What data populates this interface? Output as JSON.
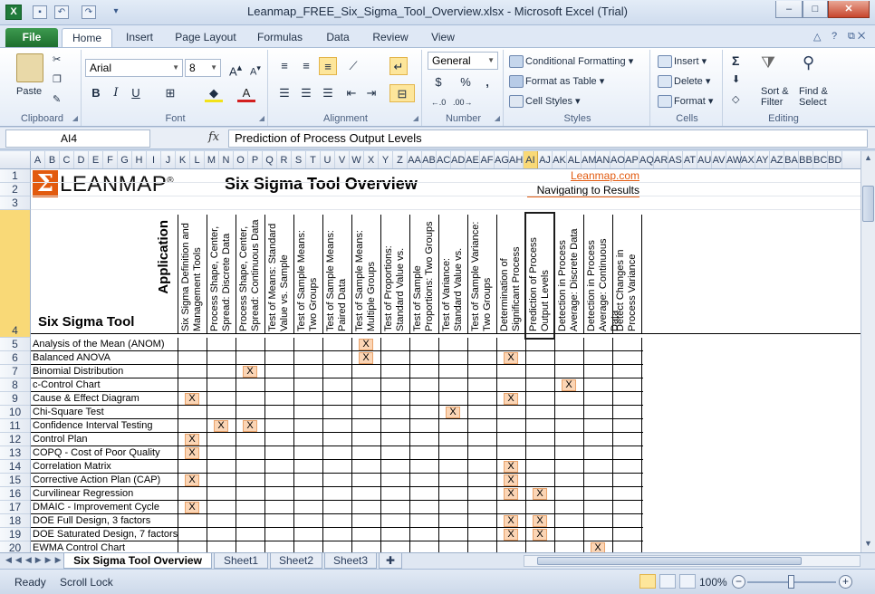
{
  "window": {
    "title": "Leanmap_FREE_Six_Sigma_Tool_Overview.xlsx  -  Microsoft Excel (Trial)",
    "app_icon": "X",
    "buttons": [
      "–",
      "□",
      "✕"
    ]
  },
  "ribbon_tabs": [
    "File",
    "Home",
    "Insert",
    "Page Layout",
    "Formulas",
    "Data",
    "Review",
    "View"
  ],
  "ribbon": {
    "clipboard": {
      "label": "Clipboard",
      "paste": "Paste"
    },
    "font": {
      "label": "Font",
      "name": "Arial",
      "size": "8",
      "bold": "B",
      "italic": "I",
      "underline": "U"
    },
    "alignment": {
      "label": "Alignment"
    },
    "number": {
      "label": "Number",
      "format": "General",
      "currency": "$",
      "percent": "%",
      "comma": ","
    },
    "styles": {
      "label": "Styles",
      "conditional": "Conditional Formatting",
      "format_table": "Format as Table",
      "cell_styles": "Cell Styles"
    },
    "cells": {
      "label": "Cells",
      "insert": "Insert",
      "delete": "Delete",
      "format": "Format"
    },
    "editing": {
      "label": "Editing",
      "sum": "Σ",
      "sort": "Sort &",
      "filter": "Filter",
      "find": "Find &",
      "select": "Select"
    }
  },
  "formula_bar": {
    "name_box": "AI4",
    "fx": "fx",
    "content": "Prediction of Process Output Levels"
  },
  "columns": [
    "A",
    "B",
    "C",
    "D",
    "E",
    "F",
    "G",
    "H",
    "I",
    "J",
    "K",
    "L",
    "M",
    "N",
    "O",
    "P",
    "Q",
    "R",
    "S",
    "T",
    "U",
    "V",
    "W",
    "X",
    "Y",
    "Z",
    "AA",
    "AB",
    "AC",
    "AD",
    "AE",
    "AF",
    "AG",
    "AH",
    "AI",
    "AJ",
    "AK",
    "AL",
    "AM",
    "AN",
    "AO",
    "AP",
    "AQ",
    "AR",
    "AS",
    "AT",
    "AU",
    "AV",
    "AW",
    "AX",
    "AY",
    "AZ",
    "BA",
    "BB",
    "BC",
    "BD"
  ],
  "selected_column": "AI",
  "rows": [
    "1",
    "2",
    "3",
    "4",
    "5",
    "6",
    "7",
    "8",
    "9",
    "10",
    "11",
    "12",
    "13",
    "14",
    "15",
    "16",
    "17",
    "18",
    "19",
    "20"
  ],
  "selected_row": "4",
  "sheet": {
    "logo_symbol": "Σ",
    "logo_text": "LEANMAP",
    "logo_reg": "®",
    "title": "Six Sigma Tool Overview",
    "link": "Leanmap.com",
    "tagline": "Navigating to Results",
    "application_label": "Application",
    "tool_label": "Six Sigma Tool",
    "application_headers": [
      "Six Sigma Definition and Management Tools",
      "Process Shape, Center, Spread: Discrete Data",
      "Process Shape, Center, Spread: Continuous Data",
      "Test of Means: Standard Value vs. Sample",
      "Test of Sample Means: Two Groups",
      "Test of Sample Means: Paired Data",
      "Test of Sample Means: Multiple Groups",
      "Test of Proportions: Standard Value vs.",
      "Test of Sample Proportions: Two Groups",
      "Test of Variance: Standard Value vs.",
      "Test of Sample Variance: Two Groups",
      "Determination of Significant Process",
      "Prediction of Process Output Levels",
      "Detection in Process Average: Discrete Data",
      "Detection in Process Average: Continuous Data",
      "Detect Changes in Process Variance"
    ],
    "tools": [
      {
        "name": "Analysis of the Mean (ANOM)",
        "marks": [
          6
        ]
      },
      {
        "name": "Balanced ANOVA",
        "marks": [
          6,
          11
        ]
      },
      {
        "name": "Binomial Distribution",
        "marks": [
          2
        ]
      },
      {
        "name": "c-Control Chart",
        "marks": [
          13
        ]
      },
      {
        "name": "Cause & Effect Diagram",
        "marks": [
          0,
          11
        ]
      },
      {
        "name": "Chi-Square Test",
        "marks": [
          9
        ]
      },
      {
        "name": "Confidence Interval Testing",
        "marks": [
          1,
          2
        ]
      },
      {
        "name": "Control Plan",
        "marks": [
          0
        ]
      },
      {
        "name": "COPQ - Cost of Poor Quality",
        "marks": [
          0
        ]
      },
      {
        "name": "Correlation Matrix",
        "marks": [
          11
        ]
      },
      {
        "name": "Corrective Action Plan (CAP)",
        "marks": [
          0,
          11
        ]
      },
      {
        "name": "Curvilinear Regression",
        "marks": [
          11,
          12
        ]
      },
      {
        "name": "DMAIC - Improvement Cycle",
        "marks": [
          0
        ]
      },
      {
        "name": "DOE Full Design, 3 factors",
        "marks": [
          11,
          12
        ]
      },
      {
        "name": "DOE Saturated Design, 7 factors",
        "marks": [
          11,
          12
        ]
      },
      {
        "name": "EWMA Control Chart",
        "marks": [
          14
        ]
      }
    ],
    "mark_symbol": "X"
  },
  "sheet_tabs": [
    "Six Sigma Tool Overview",
    "Sheet1",
    "Sheet2",
    "Sheet3"
  ],
  "status": {
    "ready": "Ready",
    "scroll_lock": "Scroll Lock",
    "zoom": "100%"
  }
}
